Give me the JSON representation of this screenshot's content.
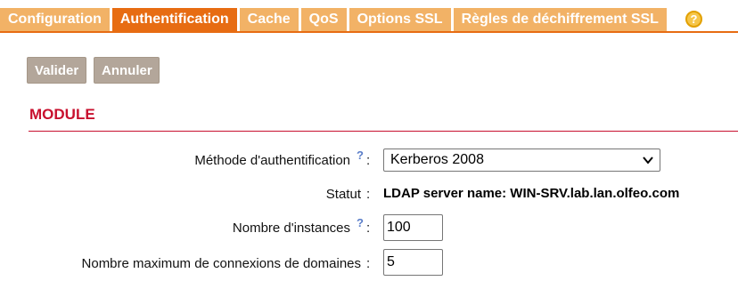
{
  "tabs": [
    {
      "label": "Configuration",
      "active": false
    },
    {
      "label": "Authentification",
      "active": true
    },
    {
      "label": "Cache",
      "active": false
    },
    {
      "label": "QoS",
      "active": false
    },
    {
      "label": "Options SSL",
      "active": false
    },
    {
      "label": "Règles de déchiffrement SSL",
      "active": false
    }
  ],
  "help_icon": "?",
  "buttons": {
    "validate": "Valider",
    "cancel": "Annuler"
  },
  "section": {
    "title": "MODULE"
  },
  "form": {
    "auth_method": {
      "label": "Méthode d'authentification",
      "help": "?",
      "colon": ":",
      "value": "Kerberos 2008"
    },
    "status": {
      "label": "Statut",
      "colon": ":",
      "value": "LDAP server name: WIN-SRV.lab.lan.olfeo.com"
    },
    "instances": {
      "label": "Nombre d'instances",
      "help": "?",
      "colon": ":",
      "value": "100"
    },
    "max_connections": {
      "label": "Nombre maximum de connexions de domaines",
      "colon": ":",
      "value": "5"
    }
  },
  "colors": {
    "tab_active": "#e76c12",
    "tab_inactive": "#f2b266",
    "button": "#b3a69a",
    "section_title": "#c8102e",
    "help_mark": "#5b7ec9"
  },
  "icons": {
    "help_tab": "help-circle-icon",
    "help_field": "question-mark-icon",
    "dropdown": "chevron-down-icon"
  }
}
